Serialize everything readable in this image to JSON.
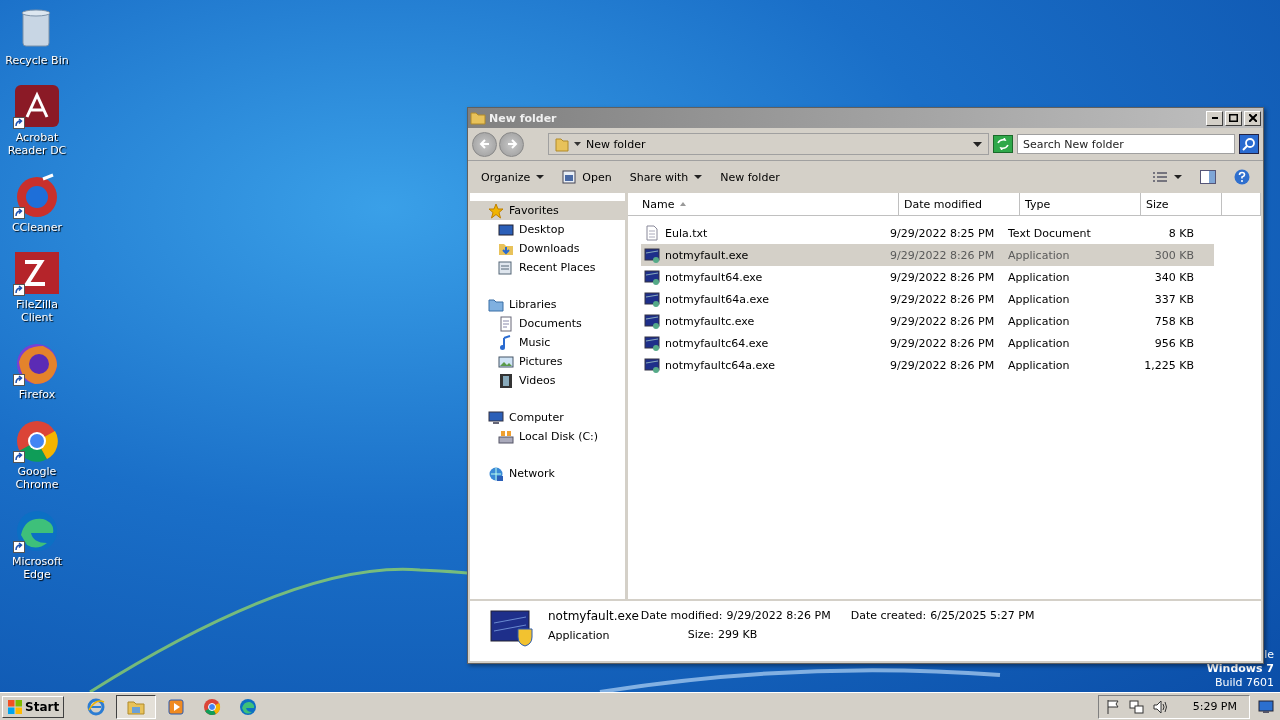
{
  "desktop_icons": [
    {
      "label": "Recycle Bin",
      "kind": "bin",
      "shortcut": false
    },
    {
      "label": "Acrobat Reader DC",
      "kind": "acrobat",
      "shortcut": true
    },
    {
      "label": "CCleaner",
      "kind": "ccleaner",
      "shortcut": true
    },
    {
      "label": "FileZilla Client",
      "kind": "filezilla",
      "shortcut": true
    },
    {
      "label": "Firefox",
      "kind": "firefox",
      "shortcut": true
    },
    {
      "label": "Google Chrome",
      "kind": "chrome",
      "shortcut": true
    },
    {
      "label": "Microsoft Edge",
      "kind": "edge",
      "shortcut": true
    }
  ],
  "window": {
    "title": "New folder",
    "address": "New folder",
    "search": {
      "placeholder": "Search New folder"
    },
    "toolbar": [
      {
        "label": "Organize",
        "kind": "menu"
      },
      {
        "label": "Open",
        "kind": "open"
      },
      {
        "label": "Share with",
        "kind": "menu"
      },
      {
        "label": "New folder",
        "kind": "plain"
      }
    ],
    "nav": [
      {
        "label": "Favorites",
        "kind": "star",
        "selected": true,
        "children": [
          {
            "label": "Desktop",
            "kind": "desktop",
            "selected": false
          },
          {
            "label": "Downloads",
            "kind": "downloads",
            "selected": false
          },
          {
            "label": "Recent Places",
            "kind": "recent",
            "selected": false
          }
        ]
      },
      {
        "label": "Libraries",
        "kind": "library",
        "selected": false,
        "children": [
          {
            "label": "Documents",
            "kind": "doc",
            "selected": false
          },
          {
            "label": "Music",
            "kind": "music",
            "selected": false
          },
          {
            "label": "Pictures",
            "kind": "pictures",
            "selected": false
          },
          {
            "label": "Videos",
            "kind": "videos",
            "selected": false
          }
        ]
      },
      {
        "label": "Computer",
        "kind": "computer",
        "selected": false,
        "children": [
          {
            "label": "Local Disk (C:)",
            "kind": "disk",
            "selected": false
          }
        ]
      },
      {
        "label": "Network",
        "kind": "network",
        "selected": false
      }
    ],
    "columns": [
      "Name",
      "Date modified",
      "Type",
      "Size"
    ],
    "rows": [
      {
        "name": "Eula.txt",
        "kind": "text",
        "date": "9/29/2022 8:25 PM",
        "type": "Text Document",
        "size": "8 KB",
        "selected": false
      },
      {
        "name": "notmyfault.exe",
        "kind": "app",
        "date": "9/29/2022 8:26 PM",
        "type": "Application",
        "size": "300 KB",
        "selected": true
      },
      {
        "name": "notmyfault64.exe",
        "kind": "app",
        "date": "9/29/2022 8:26 PM",
        "type": "Application",
        "size": "340 KB",
        "selected": false
      },
      {
        "name": "notmyfault64a.exe",
        "kind": "app",
        "date": "9/29/2022 8:26 PM",
        "type": "Application",
        "size": "337 KB",
        "selected": false
      },
      {
        "name": "notmyfaultc.exe",
        "kind": "app",
        "date": "9/29/2022 8:26 PM",
        "type": "Application",
        "size": "758 KB",
        "selected": false
      },
      {
        "name": "notmyfaultc64.exe",
        "kind": "app",
        "date": "9/29/2022 8:26 PM",
        "type": "Application",
        "size": "956 KB",
        "selected": false
      },
      {
        "name": "notmyfaultc64a.exe",
        "kind": "app",
        "date": "9/29/2022 8:26 PM",
        "type": "Application",
        "size": "1,225 KB",
        "selected": false
      }
    ],
    "details": {
      "name": "notmyfault.exe",
      "type": "Application",
      "modified_label": "Date modified:",
      "modified": "9/29/2022 8:26 PM",
      "size_label": "Size:",
      "size": "299 KB",
      "created_label": "Date created:",
      "created": "6/25/2025 5:27 PM"
    }
  },
  "os_notice": [
    "le",
    "Windows 7",
    "Build 7601"
  ],
  "taskbar": {
    "start": "Start",
    "apps": [
      {
        "kind": "ie",
        "active": false
      },
      {
        "kind": "explorer",
        "active": true
      },
      {
        "kind": "media",
        "active": false
      },
      {
        "kind": "chrome",
        "active": false
      },
      {
        "kind": "edge",
        "active": false
      }
    ],
    "time": "5:29 PM"
  }
}
